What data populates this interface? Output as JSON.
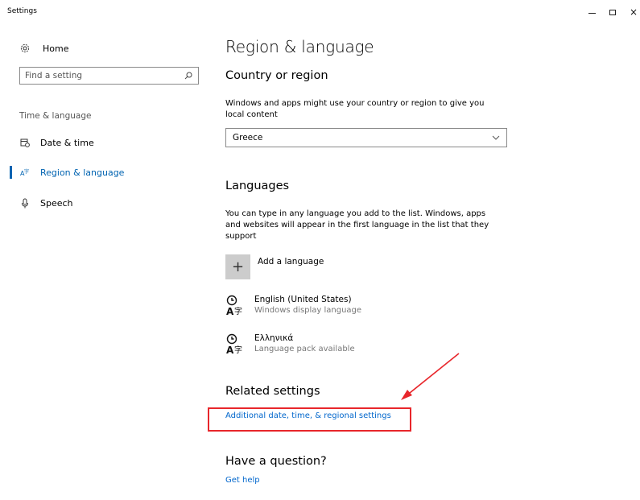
{
  "window": {
    "title": "Settings",
    "controls": {
      "minimize": "–",
      "maximize": "□",
      "close": "×"
    }
  },
  "sidebar": {
    "home_label": "Home",
    "search_placeholder": "Find a setting",
    "section_label": "Time & language",
    "items": [
      {
        "label": "Date & time",
        "icon": "calendar-clock-icon",
        "selected": false
      },
      {
        "label": "Region & language",
        "icon": "language-icon",
        "selected": true
      },
      {
        "label": "Speech",
        "icon": "microphone-icon",
        "selected": false
      }
    ]
  },
  "main": {
    "title": "Region & language",
    "country": {
      "heading": "Country or region",
      "description": "Windows and apps might use your country or region to give you local content",
      "selected_value": "Greece"
    },
    "languages": {
      "heading": "Languages",
      "description": "You can type in any language you add to the list. Windows, apps and websites will appear in the first language in the list that they support",
      "add_label": "Add a language",
      "list": [
        {
          "name": "English (United States)",
          "status": "Windows display language"
        },
        {
          "name": "Ελληνικά",
          "status": "Language pack available"
        }
      ]
    },
    "related": {
      "heading": "Related settings",
      "link": "Additional date, time, & regional settings"
    },
    "question": {
      "heading": "Have a question?",
      "link": "Get help"
    }
  },
  "colors": {
    "accent": "#0063b1",
    "link": "#0066cc",
    "annotation": "#e8262b"
  }
}
